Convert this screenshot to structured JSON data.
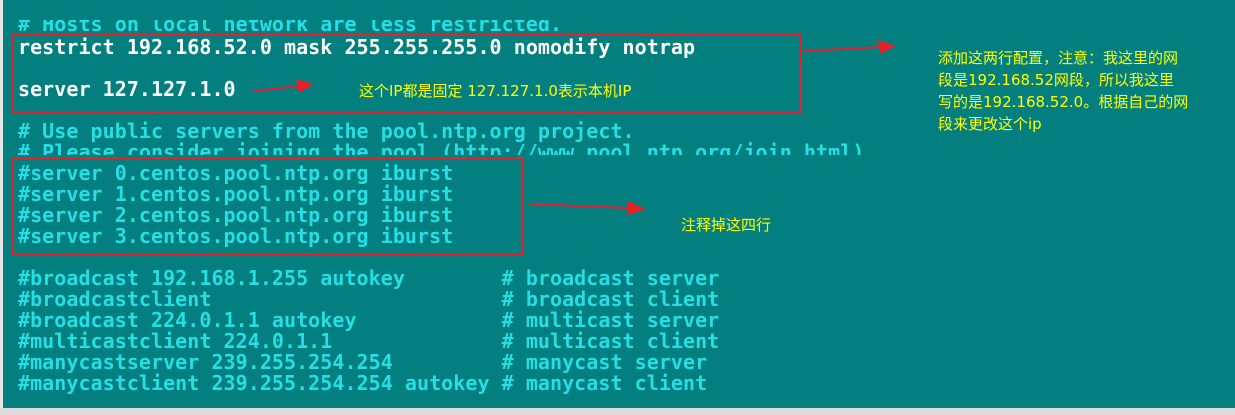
{
  "terminal": {
    "lines": [
      "# Hosts on local network are less restricted.",
      "restrict 192.168.52.0 mask 255.255.255.0 nomodify notrap",
      "server 127.127.1.0",
      "# Use public servers from the pool.ntp.org project.",
      "# Please consider joining the pool (http://www.pool.ntp.org/join.html).",
      "#server 0.centos.pool.ntp.org iburst",
      "#server 1.centos.pool.ntp.org iburst",
      "#server 2.centos.pool.ntp.org iburst",
      "#server 3.centos.pool.ntp.org iburst",
      "#broadcast 192.168.1.255 autokey        # broadcast server",
      "#broadcastclient                        # broadcast client",
      "#broadcast 224.0.1.1 autokey            # multicast server",
      "#multicastclient 224.0.1.1              # multicast client",
      "#manycastserver 239.255.254.254         # manycast server",
      "#manycastclient 239.255.254.254 autokey # manycast client"
    ]
  },
  "annotations": {
    "config_note": [
      "添加这两行配置，注意：我这里的网",
      "段是192.168.52网段，所以我这里",
      "写的是192.168.52.0。根据自己的网",
      "段来更改这个ip"
    ],
    "ip_note": "这个IP都是固定  127.127.1.0表示本机IP",
    "comment_note": "注释掉这四行"
  },
  "colors": {
    "terminal_bg": "#047f7f",
    "text_cyan": "#25dfe4",
    "text_white": "#ffffff",
    "annotation_red": "#e8202a",
    "annotation_yellow": "#ffff00"
  }
}
